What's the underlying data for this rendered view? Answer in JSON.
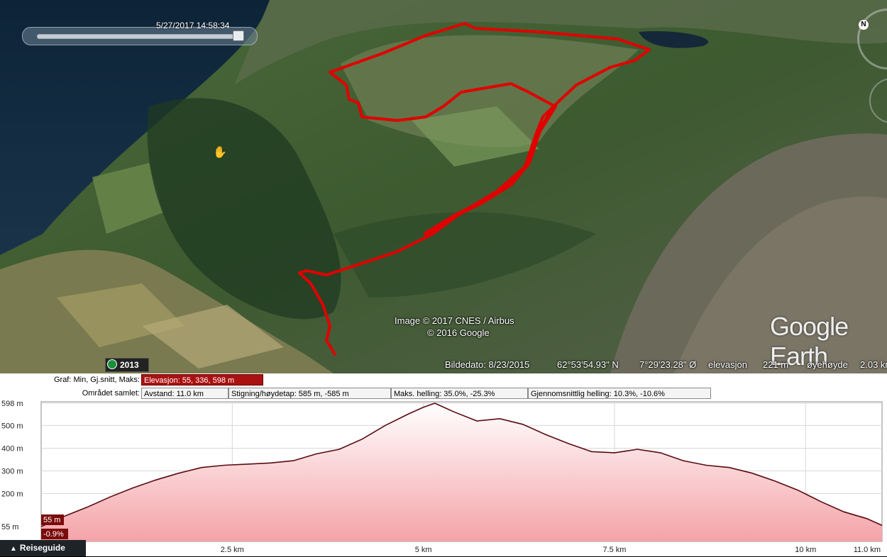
{
  "map": {
    "slider_time": "5/27/2017  14:58:34",
    "imagery_credit": "Image © 2017 CNES / Airbus",
    "copyright": "© 2016 Google",
    "logo_text": "Google Earth",
    "year": "2013",
    "status": {
      "date": "Bildedato: 8/23/2015",
      "lat": "62°53'54.93\" N",
      "lon": "7°29'23.28\" Ø",
      "elev_label": "elevasjon",
      "elev_value": "221 m",
      "eye_label": "øyehøyde",
      "eye_value": "2.03 km"
    },
    "nav_north": "N",
    "track_color": "#e00000"
  },
  "profile": {
    "row1": {
      "label": "Graf: Min, Gj.snitt, Maks:",
      "elevation": "Elevasjon: 55, 336, 598 m"
    },
    "row2": {
      "label": "Området samlet:",
      "distance": "Avstand: 11.0 km",
      "climb": "Stigning/høydetap: 585 m, -585 m",
      "max_slope": "Maks. helling: 35.0%, -25.3%",
      "avg_slope": "Gjennomsnittlig helling: 10.3%, -10.6%"
    },
    "current_elev": "55 m",
    "current_slope": "-0.9%"
  },
  "chart_data": {
    "type": "area",
    "xlabel": "",
    "ylabel": "",
    "xlim": [
      0,
      11
    ],
    "ylim": [
      0,
      598
    ],
    "y_ticks": [
      "598 m",
      "500 m",
      "400 m",
      "300 m",
      "200 m",
      "55 m"
    ],
    "y_tick_values": [
      598,
      500,
      400,
      300,
      200,
      55
    ],
    "x_ticks": [
      "2.5 km",
      "5 km",
      "7.5 km",
      "10 km",
      "11.0 km"
    ],
    "x_tick_values": [
      2.5,
      5,
      7.5,
      10,
      11
    ],
    "x": [
      0,
      0.3,
      0.6,
      0.9,
      1.2,
      1.5,
      1.8,
      2.1,
      2.4,
      2.7,
      3.0,
      3.3,
      3.6,
      3.9,
      4.2,
      4.5,
      4.8,
      5.0,
      5.15,
      5.4,
      5.7,
      6.0,
      6.3,
      6.6,
      6.9,
      7.2,
      7.5,
      7.8,
      8.1,
      8.4,
      8.7,
      9.0,
      9.3,
      9.6,
      9.9,
      10.2,
      10.5,
      10.8,
      11.0
    ],
    "values": [
      55,
      100,
      140,
      185,
      225,
      260,
      290,
      315,
      325,
      330,
      335,
      345,
      375,
      395,
      440,
      500,
      550,
      580,
      598,
      560,
      520,
      530,
      505,
      460,
      420,
      385,
      380,
      395,
      380,
      345,
      325,
      315,
      290,
      255,
      215,
      165,
      120,
      90,
      60
    ],
    "fill_top": "#ffffff",
    "fill_bottom": "#f4a3a8",
    "line_color": "#5a0a10",
    "marker_color": "#7a0b0b"
  }
}
